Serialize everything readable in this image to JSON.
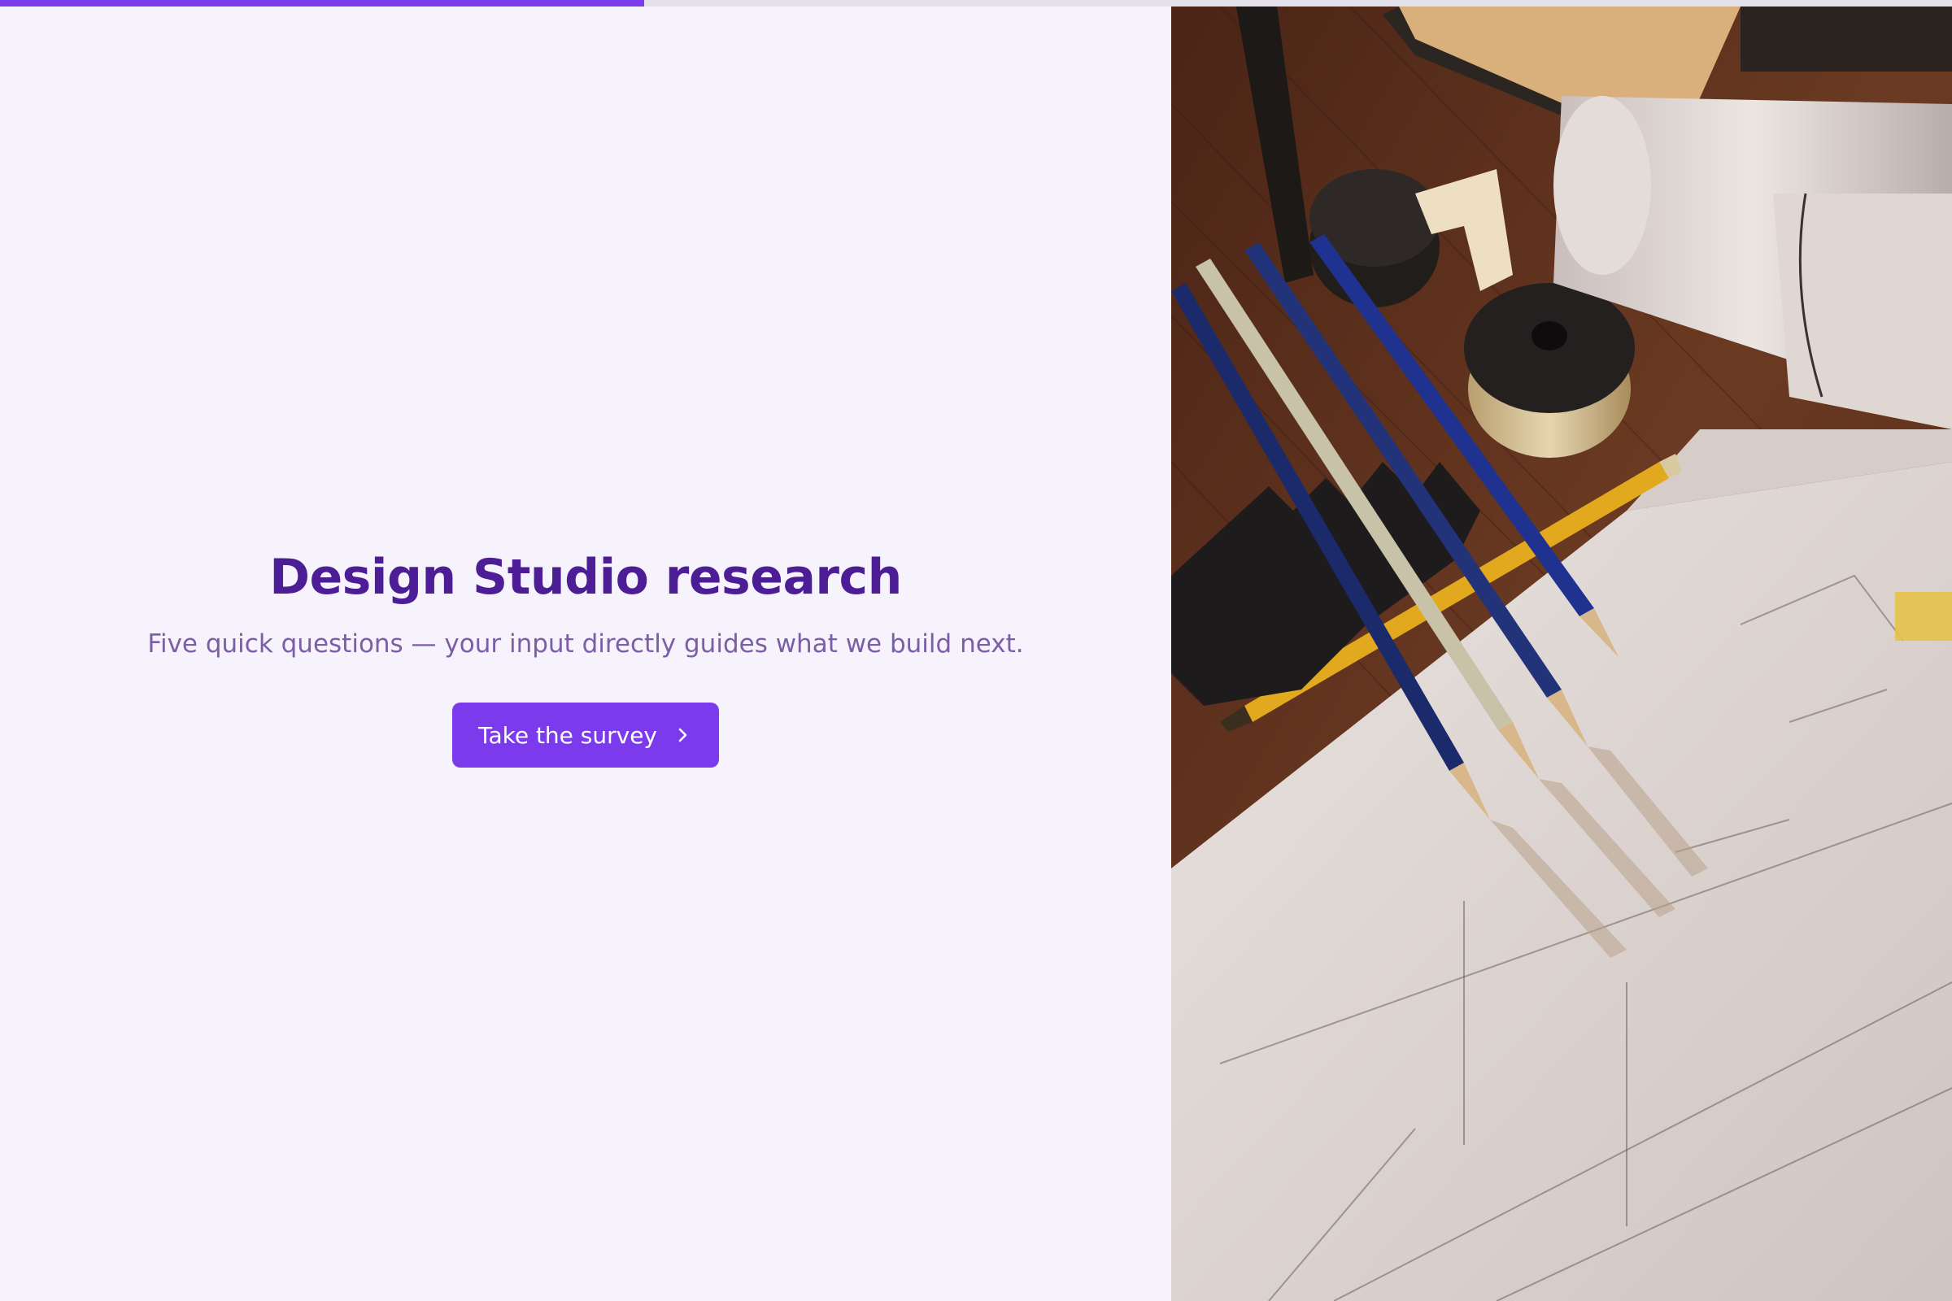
{
  "progress": {
    "fraction": 0.33
  },
  "hero": {
    "title": "Design Studio research",
    "subtitle": "Five quick questions — your input directly guides what we build next.",
    "cta_label": "Take the survey",
    "cta_icon": "chevron-right-icon"
  },
  "side_photo": {
    "icon": "photo-of-drafting-tools-and-blueprints"
  },
  "colors": {
    "accent": "#7c3aed",
    "title": "#4c1d95",
    "subtitle": "#7b5ea7",
    "background": "#f6f3fd",
    "progress_track": "#e4e1ea"
  }
}
